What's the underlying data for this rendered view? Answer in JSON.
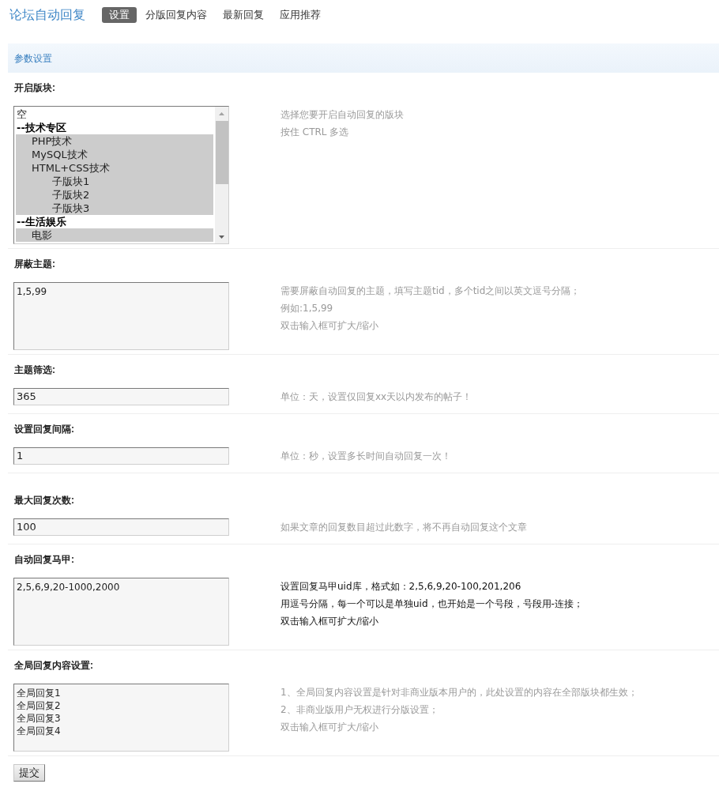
{
  "header": {
    "title": "论坛自动回复",
    "tabs": [
      {
        "label": "设置",
        "selected": true
      },
      {
        "label": "分版回复内容",
        "selected": false
      },
      {
        "label": "最新回复",
        "selected": false
      },
      {
        "label": "应用推荐",
        "selected": false
      }
    ]
  },
  "section": {
    "title": "参数设置"
  },
  "rows": [
    {
      "label": "开启版块:",
      "kind": "select",
      "options": [
        {
          "label": "空",
          "kind": "option",
          "selected": false
        },
        {
          "label": "--技术专区",
          "kind": "category",
          "selected": false,
          "children": [
            {
              "label": "PHP技术",
              "kind": "option",
              "selected": true
            },
            {
              "label": "MySQL技术",
              "kind": "option",
              "selected": true
            },
            {
              "label": "HTML+CSS技术",
              "kind": "option",
              "selected": true,
              "children": [
                {
                  "label": "子版块1",
                  "kind": "option",
                  "selected": true
                },
                {
                  "label": "子版块2",
                  "kind": "option",
                  "selected": true
                },
                {
                  "label": "子版块3",
                  "kind": "option",
                  "selected": true
                }
              ]
            }
          ]
        },
        {
          "label": "--生活娱乐",
          "kind": "category",
          "selected": false,
          "children": [
            {
              "label": "电影",
              "kind": "option",
              "selected": true
            }
          ]
        }
      ],
      "help": [
        "选择您要开启自动回复的版块",
        "按住 CTRL 多选"
      ],
      "help_emphasis": false
    },
    {
      "label": "屏蔽主题:",
      "kind": "textarea",
      "value": "1,5,99",
      "help": [
        "需要屏蔽自动回复的主题，填写主题tid，多个tid之间以英文逗号分隔；",
        "例如:1,5,99",
        "双击输入框可扩大/缩小"
      ],
      "help_emphasis": false
    },
    {
      "label": "主题筛选:",
      "kind": "input",
      "value": "365",
      "help": [
        "单位：天，设置仅回复xx天以内发布的帖子！"
      ],
      "help_emphasis": false
    },
    {
      "label": "设置回复间隔:",
      "kind": "input",
      "value": "1",
      "help": [
        "单位：秒，设置多长时间自动回复一次！"
      ],
      "help_emphasis": false
    },
    {
      "label": "最大回复次数:",
      "kind": "input",
      "value": "100",
      "help": [
        "如果文章的回复数目超过此数字，将不再自动回复这个文章"
      ],
      "help_emphasis": false
    },
    {
      "label": "自动回复马甲:",
      "kind": "textarea",
      "value": "2,5,6,9,20-1000,2000",
      "help": [
        "设置回复马甲uid库，格式如：2,5,6,9,20-100,201,206",
        "用逗号分隔，每一个可以是单独uid，也开始是一个号段，号段用-连接；",
        "双击输入框可扩大/缩小"
      ],
      "help_emphasis": true
    },
    {
      "label": "全局回复内容设置:",
      "kind": "textarea",
      "value": "全局回复1\n全局回复2\n全局回复3\n全局回复4",
      "help": [
        "1、全局回复内容设置是针对非商业版本用户的，此处设置的内容在全部版块都生效；",
        "2、非商业版用户无权进行分版设置；",
        "双击输入框可扩大/缩小"
      ],
      "help_emphasis": false
    }
  ],
  "submit": {
    "label": "提交"
  }
}
